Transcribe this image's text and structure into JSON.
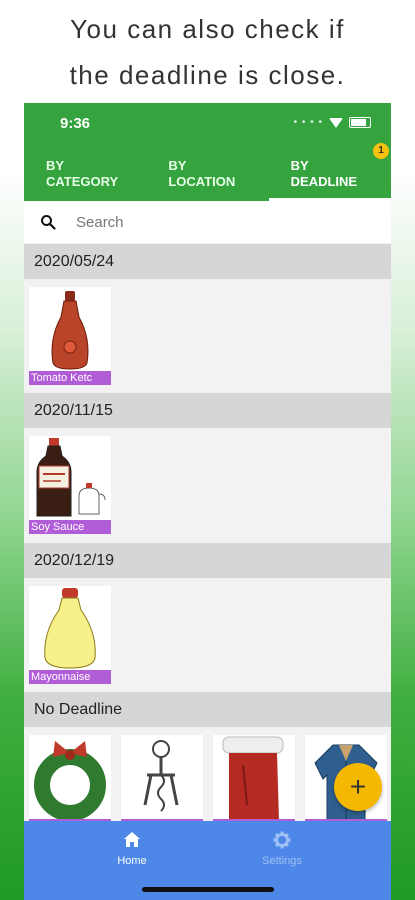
{
  "headline": {
    "line1": "You can also check if",
    "line2": "the deadline is close."
  },
  "status_bar": {
    "time": "9:36"
  },
  "tabs": [
    {
      "line1": "BY",
      "line2": "CATEGORY"
    },
    {
      "line1": "BY",
      "line2": "LOCATION"
    },
    {
      "line1": "BY",
      "line2": "DEADLINE",
      "badge": "1"
    }
  ],
  "search": {
    "placeholder": "Search"
  },
  "sections": [
    {
      "date": "2020/05/24",
      "items": [
        {
          "name": "Tomato Ketc"
        }
      ]
    },
    {
      "date": "2020/11/15",
      "items": [
        {
          "name": "Soy Sauce"
        }
      ]
    },
    {
      "date": "2020/12/19",
      "items": [
        {
          "name": "Mayonnaise"
        }
      ]
    },
    {
      "date": "No Deadline",
      "items": [
        {
          "name": ""
        },
        {
          "name": ""
        },
        {
          "name": ""
        },
        {
          "name": ""
        }
      ]
    }
  ],
  "fab": {
    "symbol": "+"
  },
  "bottom_nav": {
    "home": "Home",
    "settings": "Settings"
  },
  "colors": {
    "primary": "#35a43f",
    "bottom_nav": "#4d88e8",
    "label": "#b25dd8",
    "fab": "#f4b800"
  }
}
